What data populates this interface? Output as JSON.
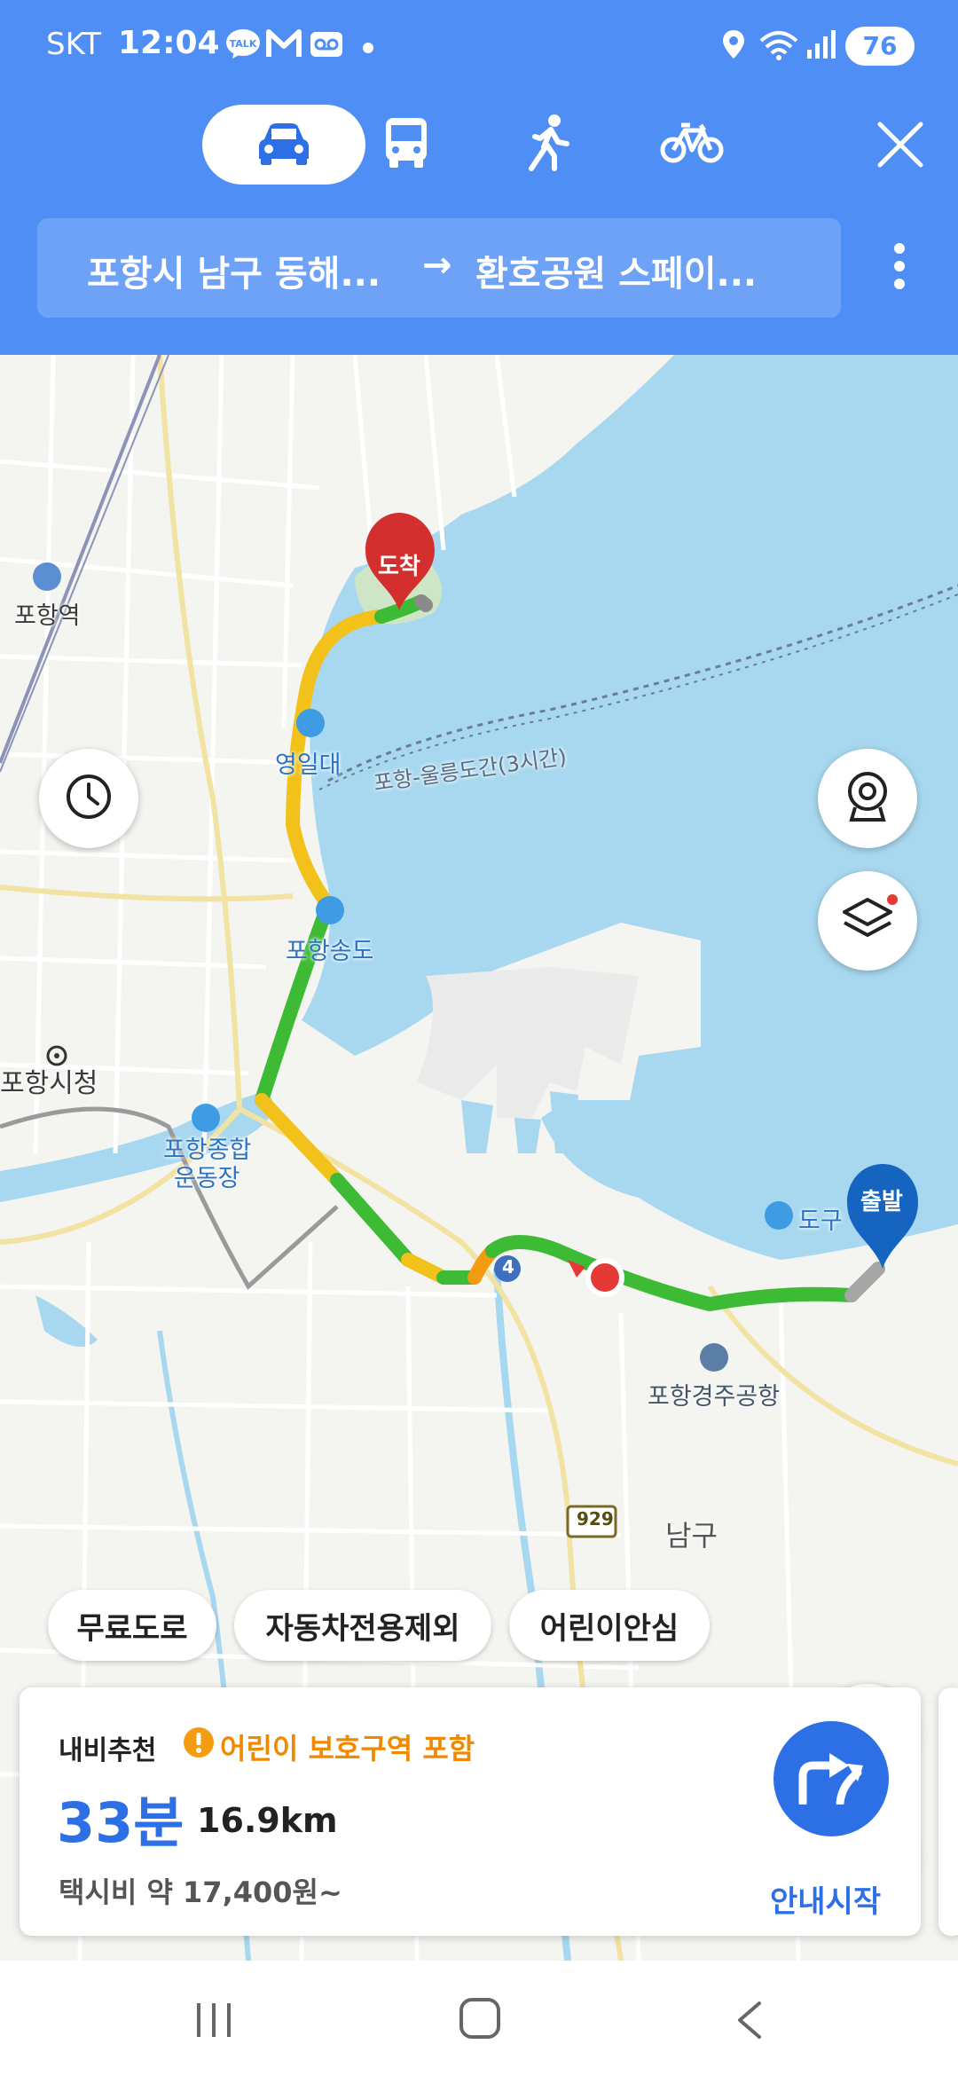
{
  "status_bar": {
    "carrier": "SKT",
    "time": "12:04",
    "battery": "76"
  },
  "transport_modes": [
    {
      "name": "car",
      "icon": "car-icon",
      "active": true
    },
    {
      "name": "bus",
      "icon": "bus-icon",
      "active": false
    },
    {
      "name": "walk",
      "icon": "walk-icon",
      "active": false
    },
    {
      "name": "bike",
      "icon": "bike-icon",
      "active": false
    }
  ],
  "route": {
    "origin": "포항시 남구 동해...",
    "arrow": "→",
    "destination": "환호공원 스페이..."
  },
  "map": {
    "labels": {
      "pohang_station": "포항역",
      "yeongildae": "영일대",
      "ferry": "포항-울릉도간(3시간)",
      "songdo": "포항송도",
      "city_hall": "포항시청",
      "stadium_line1": "포항종합",
      "stadium_line2": "운동장",
      "dogu": "도구",
      "airport": "포항경주공항",
      "namgu": "남구",
      "road_929": "929",
      "road_4": "4"
    },
    "markers": {
      "destination": "도착",
      "origin": "출발"
    },
    "colors": {
      "fast": "#3dbb35",
      "slow": "#f2c21b",
      "congested": "#f39c12",
      "water": "#a8d8ef"
    }
  },
  "route_options": [
    "무료도로",
    "자동차전용제외",
    "어린이안심"
  ],
  "summary": {
    "recommend_label": "내비추천",
    "warning": "어린이 보호구역 포함",
    "duration": "33분",
    "distance": "16.9km",
    "taxi": "택시비 약 17,400원~",
    "start_label": "안내시작"
  }
}
